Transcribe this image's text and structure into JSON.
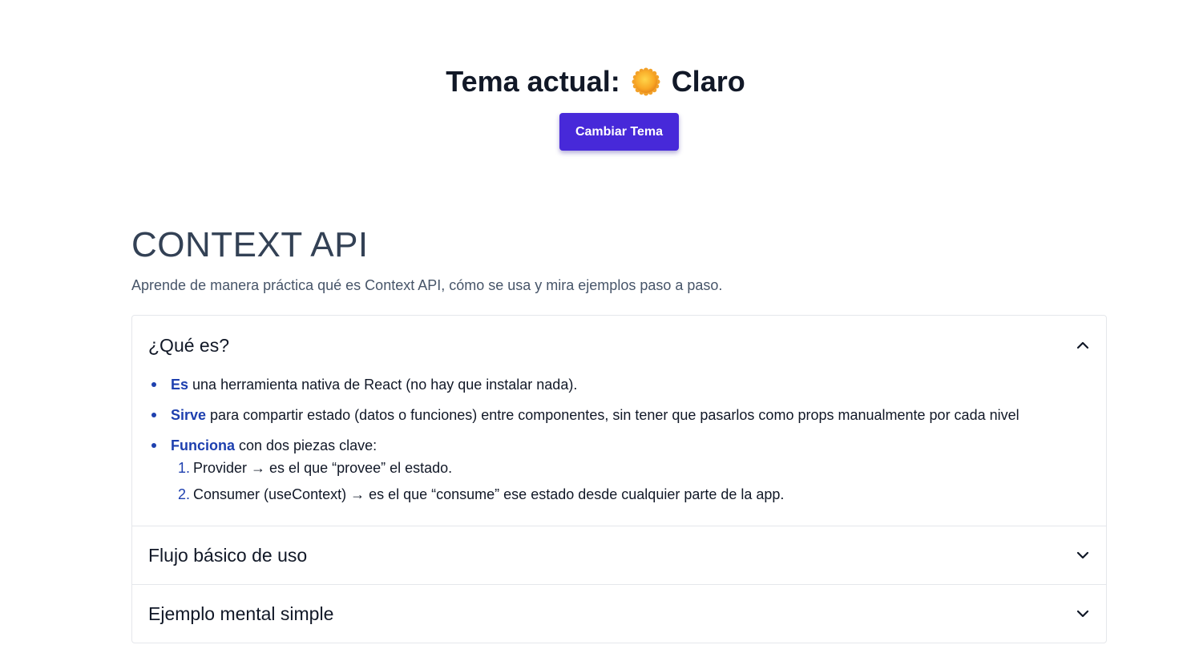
{
  "theme": {
    "title_label": "Tema actual:",
    "icon": "sun-icon",
    "current_theme": "Claro",
    "toggle_label": "Cambiar Tema",
    "accent_color": "#4729d9"
  },
  "section": {
    "title": "CONTEXT API",
    "subtitle": "Aprende de manera práctica qué es Context API, cómo se usa y mira ejemplos paso a paso."
  },
  "accordion": {
    "items": [
      {
        "title": "¿Qué es?",
        "expanded": true,
        "bullets": [
          {
            "keyword": "Es",
            "text": " una herramienta nativa de React (no hay que instalar nada)."
          },
          {
            "keyword": "Sirve",
            "text": " para compartir estado (datos o funciones) entre componentes, sin tener que pasarlos como props manualmente por cada nivel"
          },
          {
            "keyword": "Funciona",
            "text": " con dos piezas clave:"
          }
        ],
        "steps": [
          {
            "num": "1.",
            "text": "Provider → es el que “provee” el estado."
          },
          {
            "num": "2.",
            "text": "Consumer (useContext) → es el que “consume” ese estado desde cualquier parte de la app."
          }
        ]
      },
      {
        "title": "Flujo básico de uso",
        "expanded": false
      },
      {
        "title": "Ejemplo mental simple",
        "expanded": false
      }
    ]
  }
}
